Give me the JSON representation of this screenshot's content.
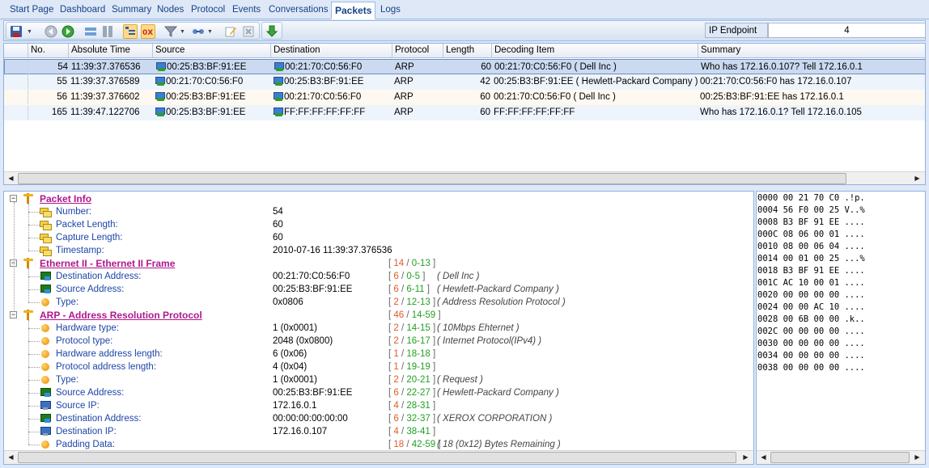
{
  "tabs": [
    {
      "label": "Start Page",
      "active": false
    },
    {
      "label": "Dashboard",
      "active": false
    },
    {
      "label": "Summary",
      "active": false
    },
    {
      "label": "Nodes",
      "active": false
    },
    {
      "label": "Protocol",
      "active": false
    },
    {
      "label": "Events",
      "active": false
    },
    {
      "label": "Conversations",
      "active": false
    },
    {
      "label": "Packets",
      "active": true
    },
    {
      "label": "Logs",
      "active": false
    }
  ],
  "toolbar": {
    "ip_endpoint_label": "IP Endpoint",
    "ip_endpoint_value": "4",
    "icons": [
      "save-icon",
      "back-icon",
      "forward-icon",
      "pane-horizontal-icon",
      "pane-vertical-icon",
      "decode-view-icon",
      "hex-view-icon",
      "filter-icon",
      "connection-icon",
      "edit-icon",
      "clear-icon",
      "download-icon"
    ]
  },
  "packet_list": {
    "columns": [
      "No.",
      "Absolute Time",
      "Source",
      "Destination",
      "Protocol",
      "Length",
      "Decoding Item",
      "Summary"
    ],
    "rows": [
      {
        "no": "54",
        "time": "11:39:37.376536",
        "source": "00:25:B3:BF:91:EE",
        "destination": "00:21:70:C0:56:F0",
        "protocol": "ARP",
        "length": "60",
        "decoding": "00:21:70:C0:56:F0 ( Dell Inc )",
        "summary": "Who has 172.16.0.107? Tell 172.16.0.1"
      },
      {
        "no": "55",
        "time": "11:39:37.376589",
        "source": "00:21:70:C0:56:F0",
        "destination": "00:25:B3:BF:91:EE",
        "protocol": "ARP",
        "length": "42",
        "decoding": "00:25:B3:BF:91:EE ( Hewlett-Packard Company )",
        "summary": "00:21:70:C0:56:F0 has 172.16.0.107"
      },
      {
        "no": "56",
        "time": "11:39:37.376602",
        "source": "00:25:B3:BF:91:EE",
        "destination": "00:21:70:C0:56:F0",
        "protocol": "ARP",
        "length": "60",
        "decoding": "00:21:70:C0:56:F0 ( Dell Inc )",
        "summary": "00:25:B3:BF:91:EE has 172.16.0.1"
      },
      {
        "no": "165",
        "time": "11:39:47.122706",
        "source": "00:25:B3:BF:91:EE",
        "destination": "FF:FF:FF:FF:FF:FF",
        "protocol": "ARP",
        "length": "60",
        "decoding": "FF:FF:FF:FF:FF:FF",
        "summary": "Who has 172.16.0.1? Tell 172.16.0.105"
      }
    ]
  },
  "decode": {
    "lines": [
      {
        "kind": "section",
        "label": "Packet Info",
        "icon": "section-icon",
        "value": "",
        "r1": "",
        "r2": "",
        "desc": ""
      },
      {
        "kind": "field",
        "label": "Number:",
        "icon": "field-tag-icon",
        "value": "54",
        "r1": "",
        "r2": "",
        "desc": ""
      },
      {
        "kind": "field",
        "label": "Packet Length:",
        "icon": "field-tag-icon",
        "value": "60",
        "r1": "",
        "r2": "",
        "desc": ""
      },
      {
        "kind": "field",
        "label": "Capture Length:",
        "icon": "field-tag-icon",
        "value": "60",
        "r1": "",
        "r2": "",
        "desc": ""
      },
      {
        "kind": "field",
        "label": "Timestamp:",
        "icon": "field-tag-icon",
        "value": "2010-07-16 11:39:37.376536",
        "r1": "",
        "r2": "",
        "desc": ""
      },
      {
        "kind": "section",
        "label": "Ethernet II - Ethernet II Frame",
        "icon": "section-icon",
        "value": "",
        "r1": "14",
        "r2": "0-13",
        "desc": ""
      },
      {
        "kind": "field",
        "label": "Destination Address:",
        "icon": "mac-address-icon",
        "value": "00:21:70:C0:56:F0",
        "r1": "6",
        "r2": "0-5",
        "desc": "( Dell Inc )"
      },
      {
        "kind": "field",
        "label": "Source Address:",
        "icon": "mac-address-icon",
        "value": "00:25:B3:BF:91:EE",
        "r1": "6",
        "r2": "6-11",
        "desc": "( Hewlett-Packard Company )"
      },
      {
        "kind": "field",
        "label": "Type:",
        "icon": "field-dot-icon",
        "value": "0x0806",
        "r1": "2",
        "r2": "12-13",
        "desc": "( Address Resolution Protocol )"
      },
      {
        "kind": "section",
        "label": "ARP - Address Resolution Protocol",
        "icon": "section-icon",
        "value": "",
        "r1": "46",
        "r2": "14-59",
        "desc": ""
      },
      {
        "kind": "field",
        "label": "Hardware type:",
        "icon": "field-dot-icon",
        "value": "1 (0x0001)",
        "r1": "2",
        "r2": "14-15",
        "desc": "( 10Mbps Ehternet )"
      },
      {
        "kind": "field",
        "label": "Protocol type:",
        "icon": "field-dot-icon",
        "value": "2048 (0x0800)",
        "r1": "2",
        "r2": "16-17",
        "desc": "( Internet Protocol(IPv4) )"
      },
      {
        "kind": "field",
        "label": "Hardware address length:",
        "icon": "field-dot-icon",
        "value": "6 (0x06)",
        "r1": "1",
        "r2": "18-18",
        "desc": ""
      },
      {
        "kind": "field",
        "label": "Protocol address length:",
        "icon": "field-dot-icon",
        "value": "4 (0x04)",
        "r1": "1",
        "r2": "19-19",
        "desc": ""
      },
      {
        "kind": "field",
        "label": "Type:",
        "icon": "field-dot-icon",
        "value": "1 (0x0001)",
        "r1": "2",
        "r2": "20-21",
        "desc": "( Request )"
      },
      {
        "kind": "field",
        "label": "Source Address:",
        "icon": "mac-address-icon",
        "value": "00:25:B3:BF:91:EE",
        "r1": "6",
        "r2": "22-27",
        "desc": "( Hewlett-Packard Company )"
      },
      {
        "kind": "field",
        "label": "Source IP:",
        "icon": "ip-address-icon",
        "value": "172.16.0.1",
        "r1": "4",
        "r2": "28-31",
        "desc": ""
      },
      {
        "kind": "field",
        "label": "Destination Address:",
        "icon": "mac-address-icon",
        "value": "00:00:00:00:00:00",
        "r1": "6",
        "r2": "32-37",
        "desc": "( XEROX CORPORATION )"
      },
      {
        "kind": "field",
        "label": "Destination IP:",
        "icon": "ip-address-icon",
        "value": "172.16.0.107",
        "r1": "4",
        "r2": "38-41",
        "desc": ""
      },
      {
        "kind": "field",
        "label": "Padding Data:",
        "icon": "field-dot-icon",
        "value": "",
        "r1": "18",
        "r2": "42-59",
        "desc": "( 18 (0x12) Bytes Remaining )"
      }
    ]
  },
  "hex": {
    "lines": [
      "0000 00 21 70 C0 .!p.",
      "0004 56 F0 00 25 V..%",
      "0008 B3 BF 91 EE ....",
      "000C 08 06 00 01 ....",
      "0010 08 00 06 04 ....",
      "0014 00 01 00 25 ...%",
      "0018 B3 BF 91 EE ....",
      "001C AC 10 00 01 ....",
      "0020 00 00 00 00 ....",
      "0024 00 00 AC 10 ....",
      "0028 00 6B 00 00 .k..",
      "002C 00 00 00 00 ....",
      "0030 00 00 00 00 ....",
      "0034 00 00 00 00 ....",
      "0038 00 00 00 00 ...."
    ]
  }
}
